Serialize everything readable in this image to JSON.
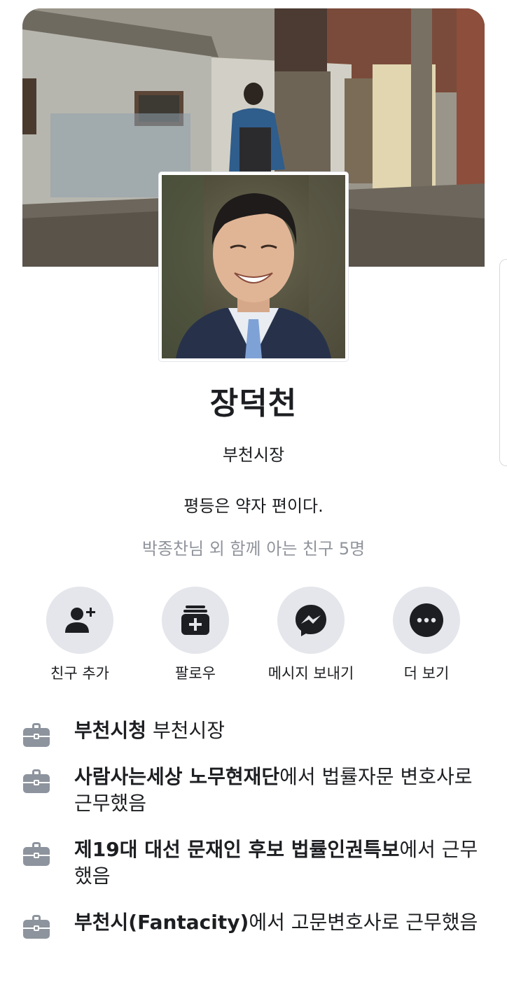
{
  "profile": {
    "name": "장덕천",
    "subtitle": "부천시장",
    "bio": "평등은 약자 편이다.",
    "mutual_friends": "박종찬님 외 함께 아는 친구 5명"
  },
  "actions": [
    {
      "label": "친구 추가",
      "icon": "add-friend-icon"
    },
    {
      "label": "팔로우",
      "icon": "follow-icon"
    },
    {
      "label": "메시지 보내기",
      "icon": "messenger-icon"
    },
    {
      "label": "더 보기",
      "icon": "more-icon"
    }
  ],
  "work": [
    {
      "bold": "부천시청",
      "rest": " 부천시장",
      "icon": "briefcase-icon"
    },
    {
      "bold": "사람사는세상 노무현재단",
      "rest": "에서 법률자문 변호사로 근무했음",
      "icon": "briefcase-icon"
    },
    {
      "bold": "제19대 대선 문재인 후보 법률인권특보",
      "rest": "에서 근무했음",
      "icon": "briefcase-icon"
    },
    {
      "bold": "부천시(Fantacity)",
      "rest": "에서 고문변호사로 근무했음",
      "icon": "briefcase-icon"
    }
  ],
  "colors": {
    "action_circle": "#e4e6eb",
    "icon_dark": "#1c1e21",
    "muted_text": "#90949c",
    "briefcase": "#8d949e"
  }
}
